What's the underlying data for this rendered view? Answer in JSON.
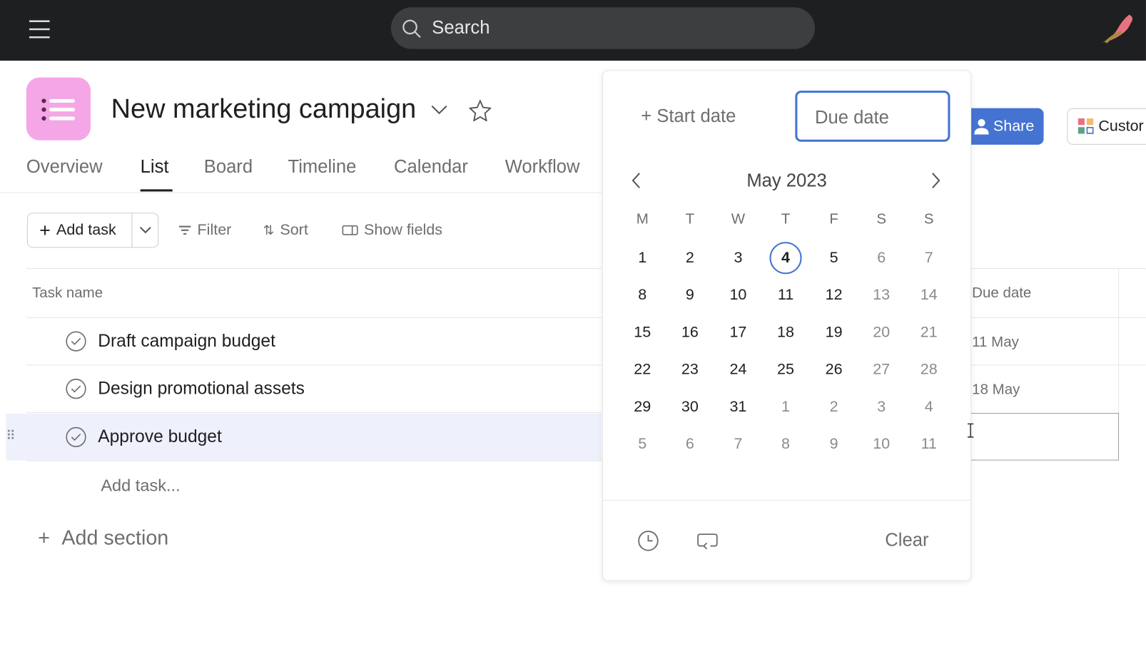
{
  "topbar": {
    "search_placeholder": "Search",
    "menu_icon": "hamburger-icon",
    "avatar_icon": "bird-logo"
  },
  "project": {
    "title": "New marketing campaign",
    "icon_color": "#f5a6e6"
  },
  "tabs": [
    {
      "label": "Overview"
    },
    {
      "label": "List",
      "active": true
    },
    {
      "label": "Board"
    },
    {
      "label": "Timeline"
    },
    {
      "label": "Calendar"
    },
    {
      "label": "Workflow"
    }
  ],
  "header_actions": {
    "share": "Share",
    "customize": "Custor",
    "share_color": "#4573d2"
  },
  "toolbar": {
    "add_task": "Add task",
    "filter": "Filter",
    "sort": "Sort",
    "show_fields": "Show fields"
  },
  "table": {
    "col_task": "Task name",
    "col_due": "Due date",
    "rows": [
      {
        "name": "Draft campaign budget",
        "due": "11 May"
      },
      {
        "name": "Design promotional assets",
        "due": "18 May"
      },
      {
        "name": "Approve budget",
        "due": ""
      }
    ],
    "add_task": "Add task...",
    "add_section": "Add section"
  },
  "datepicker": {
    "start_date": "Start date",
    "due_date_placeholder": "Due date",
    "month": "May 2023",
    "selected_day": "4",
    "weekdays": [
      "M",
      "T",
      "W",
      "T",
      "F",
      "S",
      "S"
    ],
    "weeks": [
      [
        "1",
        "2",
        "3",
        "4",
        "5",
        "6",
        "7"
      ],
      [
        "8",
        "9",
        "10",
        "11",
        "12",
        "13",
        "14"
      ],
      [
        "15",
        "16",
        "17",
        "18",
        "19",
        "20",
        "21"
      ],
      [
        "22",
        "23",
        "24",
        "25",
        "26",
        "27",
        "28"
      ],
      [
        "29",
        "30",
        "31",
        "1",
        "2",
        "3",
        "4"
      ],
      [
        "5",
        "6",
        "7",
        "8",
        "9",
        "10",
        "11"
      ]
    ],
    "clear": "Clear",
    "accent": "#4573d2"
  }
}
